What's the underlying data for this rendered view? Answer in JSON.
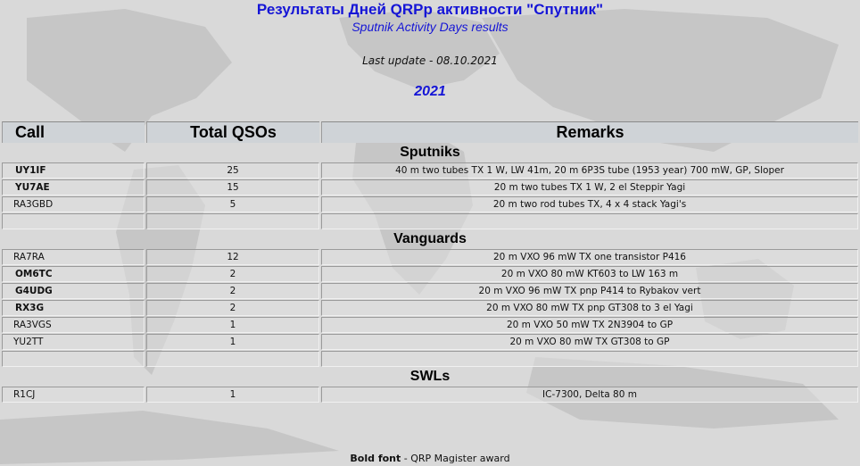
{
  "header": {
    "title": "Результаты Дней QRPp активности \"Спутник\"",
    "subtitle": "Sputnik Activity Days results",
    "last_update": "Last update - 08.10.2021",
    "year": "2021"
  },
  "table": {
    "columns": [
      "Call",
      "Total QSOs",
      "Remarks"
    ],
    "sections": [
      {
        "title": "Sputniks",
        "rows": [
          {
            "call": "UY1IF",
            "bold": true,
            "qsos": "25",
            "remarks": "40 m two tubes TX 1 W, LW 41m, 20 m 6P3S tube (1953 year) 700 mW, GP, Sloper"
          },
          {
            "call": "YU7AE",
            "bold": true,
            "qsos": "15",
            "remarks": "20 m two tubes TX 1 W, 2 el Steppir Yagi"
          },
          {
            "call": "RA3GBD",
            "bold": false,
            "qsos": "5",
            "remarks": "20 m two rod tubes TX, 4 x 4 stack Yagi's"
          }
        ]
      },
      {
        "title": "Vanguards",
        "rows": [
          {
            "call": "RA7RA",
            "bold": false,
            "qsos": "12",
            "remarks": "20 m VXO 96 mW TX one transistor P416"
          },
          {
            "call": "OM6TC",
            "bold": true,
            "qsos": "2",
            "remarks": "20 m VXO 80 mW KT603 to LW 163 m"
          },
          {
            "call": "G4UDG",
            "bold": true,
            "qsos": "2",
            "remarks": "20 m VXO 96 mW TX pnp P414 to Rybakov vert"
          },
          {
            "call": "RX3G",
            "bold": true,
            "qsos": "2",
            "remarks": "20 m VXO 80 mW TX pnp GT308 to 3 el Yagi"
          },
          {
            "call": "RA3VGS",
            "bold": false,
            "qsos": "1",
            "remarks": "20 m VXO 50 mW TX 2N3904 to GP"
          },
          {
            "call": "YU2TT",
            "bold": false,
            "qsos": "1",
            "remarks": "20 m VXO 80 mW TX GT308 to GP"
          }
        ]
      },
      {
        "title": "SWLs",
        "rows": [
          {
            "call": "R1CJ",
            "bold": false,
            "qsos": "1",
            "remarks": "IC-7300, Delta 80 m"
          }
        ]
      }
    ]
  },
  "footer": {
    "bold_part": "Bold font",
    "rest": " - QRP Magister award"
  }
}
